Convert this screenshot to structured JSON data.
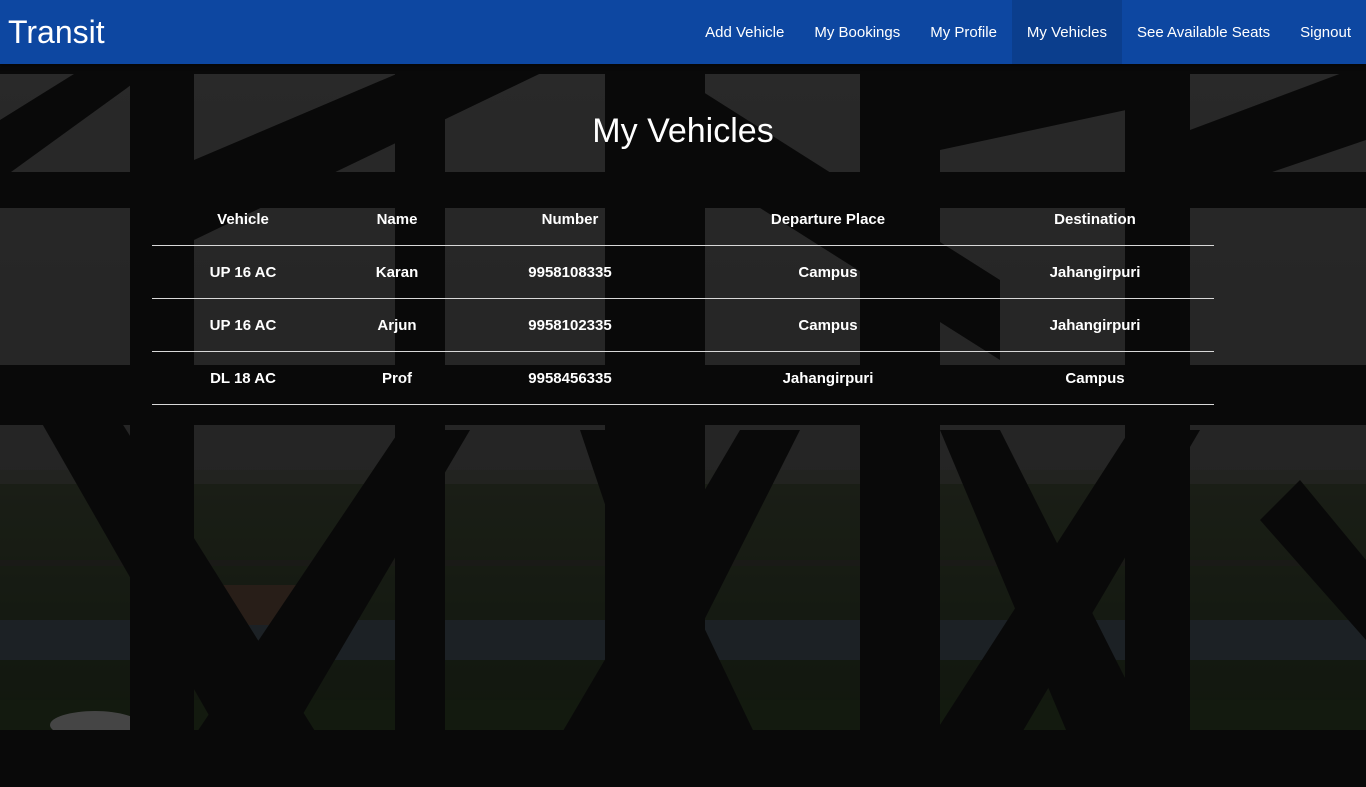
{
  "app": {
    "brand": "Transit"
  },
  "nav": {
    "items": [
      {
        "label": "Add Vehicle"
      },
      {
        "label": "My Bookings"
      },
      {
        "label": "My Profile"
      },
      {
        "label": "My Vehicles"
      },
      {
        "label": "See Available Seats"
      },
      {
        "label": "Signout"
      }
    ],
    "active": "My Vehicles"
  },
  "page": {
    "title": "My Vehicles"
  },
  "table": {
    "columns": [
      "Vehicle",
      "Name",
      "Number",
      "Departure Place",
      "Destination"
    ],
    "rows": [
      [
        "UP 16 AC",
        "Karan",
        "9958108335",
        "Campus",
        "Jahangirpuri"
      ],
      [
        "UP 16 AC",
        "Arjun",
        "9958102335",
        "Campus",
        "Jahangirpuri"
      ],
      [
        "DL 18 AC",
        "Prof",
        "9958456335",
        "Jahangirpuri",
        "Campus"
      ]
    ]
  },
  "colors": {
    "navbar": "#0d47a1",
    "text": "#ffffff",
    "row_divider": "#d8d8d8"
  }
}
